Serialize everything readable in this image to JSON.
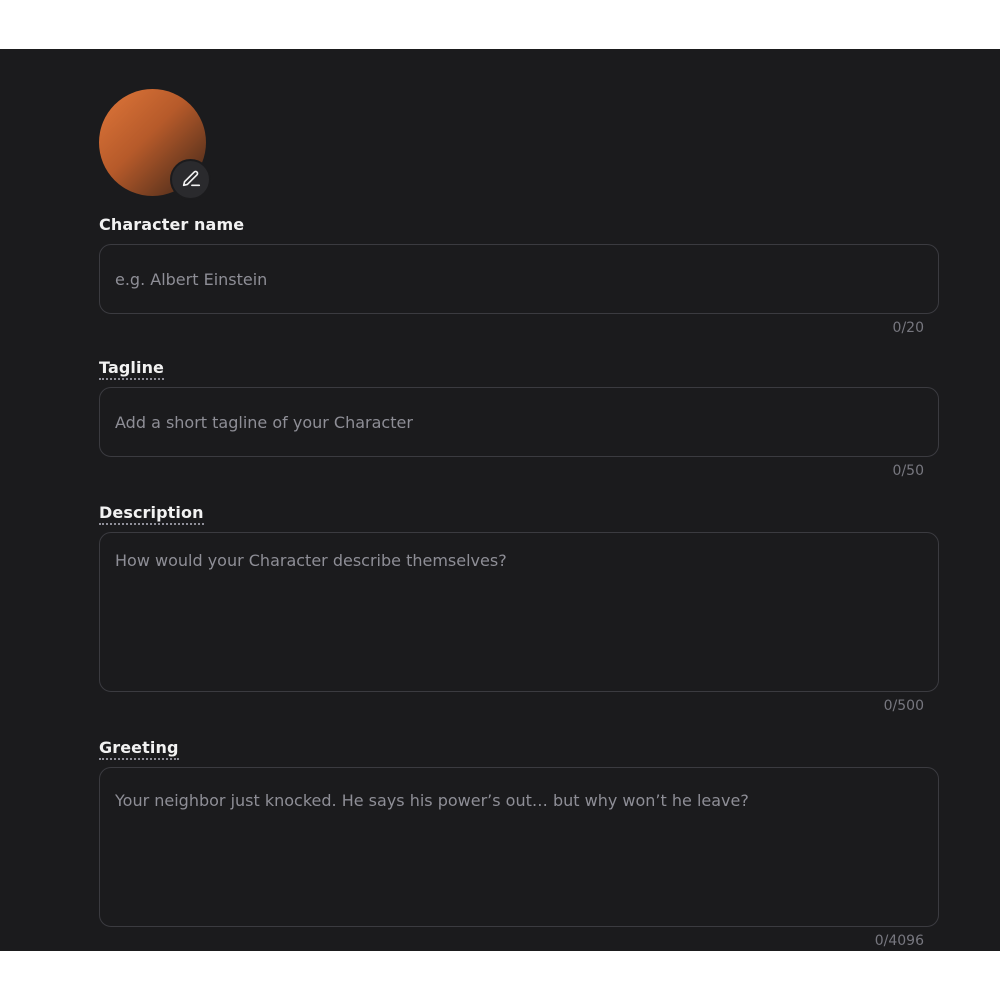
{
  "avatar": {
    "edit_icon": "pencil-icon"
  },
  "fields": {
    "character_name": {
      "label": "Character name",
      "placeholder": "e.g. Albert Einstein",
      "counter": "0/20"
    },
    "tagline": {
      "label": "Tagline",
      "placeholder": "Add a short tagline of your Character",
      "counter": "0/50"
    },
    "description": {
      "label": "Description",
      "placeholder": "How would your Character describe themselves?",
      "counter": "0/500"
    },
    "greeting": {
      "label": "Greeting",
      "placeholder": "Your neighbor just knocked. He says his power’s out… but why won’t he leave?",
      "counter": "0/4096"
    }
  },
  "colors": {
    "background": "#1b1b1d",
    "avatar_gradient_start": "#e0773a",
    "avatar_gradient_end": "#3a2418"
  }
}
